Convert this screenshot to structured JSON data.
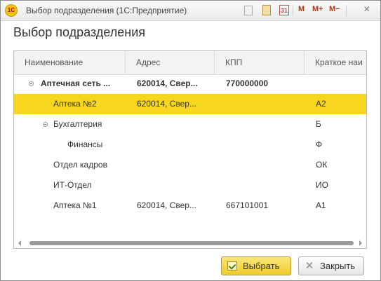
{
  "window": {
    "title": "Выбор подразделения  (1С:Предприятие)",
    "app_icon_text": "1С",
    "toolbar": {
      "calendar_day": "31",
      "m_label": "M",
      "m_plus_label": "M+",
      "m_minus_label": "M−",
      "close_glyph": "×"
    }
  },
  "form": {
    "heading": "Выбор подразделения"
  },
  "table": {
    "columns": [
      "Наименование",
      "Адрес",
      "КПП",
      "Краткое наи"
    ],
    "rows": [
      {
        "name": "Аптечная сеть ...",
        "address": "620014, Свер...",
        "kpp": "770000000",
        "short": "",
        "bold": true,
        "expanded": true,
        "level": 0
      },
      {
        "name": "Аптека №2",
        "address": "620014, Свер...",
        "kpp": "",
        "short": "А2",
        "bold": false,
        "selected": true,
        "level": 1
      },
      {
        "name": "Бухгалтерия",
        "address": "",
        "kpp": "",
        "short": "Б",
        "bold": false,
        "expanded": true,
        "level": 1
      },
      {
        "name": "Финансы",
        "address": "",
        "kpp": "",
        "short": "Ф",
        "bold": false,
        "level": 2
      },
      {
        "name": "Отдел кадров",
        "address": "",
        "kpp": "",
        "short": "ОК",
        "bold": false,
        "level": 1
      },
      {
        "name": "ИТ-Отдел",
        "address": "",
        "kpp": "",
        "short": "ИО",
        "bold": false,
        "level": 1
      },
      {
        "name": "Аптека №1",
        "address": "620014, Свер...",
        "kpp": "667101001",
        "short": "А1",
        "bold": false,
        "level": 1
      }
    ]
  },
  "buttons": {
    "select_label": "Выбрать",
    "close_label": "Закрыть"
  },
  "colors": {
    "selected_row": "#f7d71d",
    "primary_button": "#f0cb2a"
  }
}
